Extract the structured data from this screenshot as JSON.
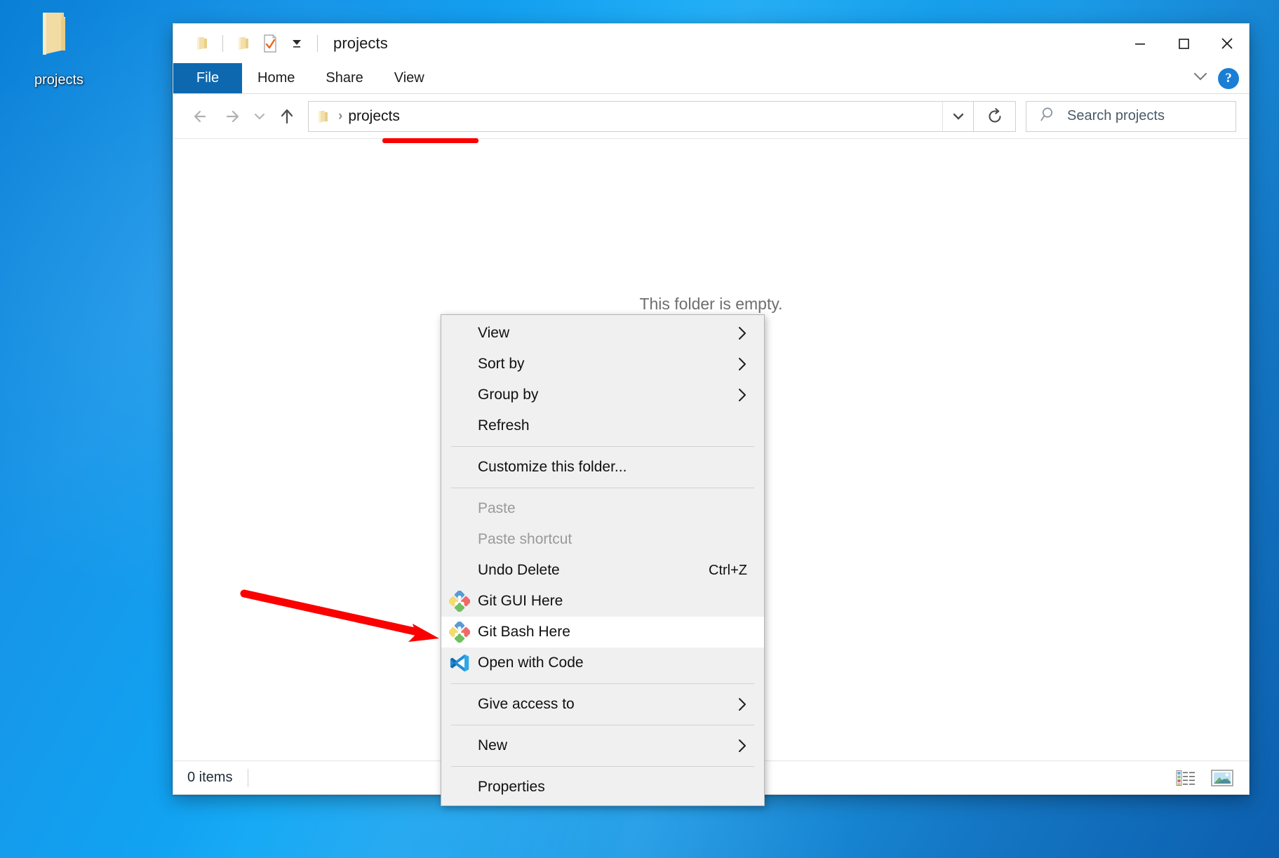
{
  "desktop": {
    "icon": {
      "name": "projects",
      "icon": "folder-icon"
    }
  },
  "window": {
    "title": "projects",
    "quick_access": [
      {
        "name": "folder-icon"
      },
      {
        "name": "folder-icon"
      },
      {
        "name": "properties-checkmark-icon"
      },
      {
        "name": "chevron-down-icon"
      }
    ],
    "controls": {
      "minimize": "minimize-icon",
      "maximize": "maximize-icon",
      "close": "close-icon"
    },
    "ribbon": {
      "tabs": [
        {
          "label": "File",
          "active": true
        },
        {
          "label": "Home",
          "active": false
        },
        {
          "label": "Share",
          "active": false
        },
        {
          "label": "View",
          "active": false
        }
      ],
      "expand_icon": "chevron-down-icon",
      "help_label": "?"
    },
    "address_bar": {
      "back_icon": "arrow-left-icon",
      "forward_icon": "arrow-right-icon",
      "recent_icon": "chevron-down-icon",
      "up_icon": "arrow-up-icon",
      "folder_icon": "folder-icon",
      "separator": "›",
      "path": "projects",
      "dropdown_icon": "chevron-down-icon",
      "refresh_icon": "refresh-icon"
    },
    "search": {
      "icon": "search-icon",
      "placeholder": "Search projects"
    },
    "content": {
      "empty_message": "This folder is empty."
    },
    "status_bar": {
      "items_count": "0 items",
      "view_buttons": [
        {
          "name": "details-view-icon"
        },
        {
          "name": "large-icons-view-icon"
        }
      ]
    }
  },
  "context_menu": {
    "items": [
      {
        "label": "View",
        "icon": null,
        "submenu": true,
        "disabled": false,
        "accel": null,
        "highlight": false
      },
      {
        "label": "Sort by",
        "icon": null,
        "submenu": true,
        "disabled": false,
        "accel": null,
        "highlight": false
      },
      {
        "label": "Group by",
        "icon": null,
        "submenu": true,
        "disabled": false,
        "accel": null,
        "highlight": false
      },
      {
        "label": "Refresh",
        "icon": null,
        "submenu": false,
        "disabled": false,
        "accel": null,
        "highlight": false
      },
      {
        "separator": true
      },
      {
        "label": "Customize this folder...",
        "icon": null,
        "submenu": false,
        "disabled": false,
        "accel": null,
        "highlight": false
      },
      {
        "separator": true
      },
      {
        "label": "Paste",
        "icon": null,
        "submenu": false,
        "disabled": true,
        "accel": null,
        "highlight": false
      },
      {
        "label": "Paste shortcut",
        "icon": null,
        "submenu": false,
        "disabled": true,
        "accel": null,
        "highlight": false
      },
      {
        "label": "Undo Delete",
        "icon": null,
        "submenu": false,
        "disabled": false,
        "accel": "Ctrl+Z",
        "highlight": false
      },
      {
        "label": "Git GUI Here",
        "icon": "git-icon",
        "submenu": false,
        "disabled": false,
        "accel": null,
        "highlight": false
      },
      {
        "label": "Git Bash Here",
        "icon": "git-icon",
        "submenu": false,
        "disabled": false,
        "accel": null,
        "highlight": true
      },
      {
        "label": "Open with Code",
        "icon": "vscode-icon",
        "submenu": false,
        "disabled": false,
        "accel": null,
        "highlight": false
      },
      {
        "separator": true
      },
      {
        "label": "Give access to",
        "icon": null,
        "submenu": true,
        "disabled": false,
        "accel": null,
        "highlight": false
      },
      {
        "separator": true
      },
      {
        "label": "New",
        "icon": null,
        "submenu": true,
        "disabled": false,
        "accel": null,
        "highlight": false
      },
      {
        "separator": true
      },
      {
        "label": "Properties",
        "icon": null,
        "submenu": false,
        "disabled": false,
        "accel": null,
        "highlight": false
      }
    ]
  },
  "annotations": {
    "color": "#fb0000",
    "arrow": {
      "name": "red-arrow-pointing-to-git-bash-here"
    },
    "underline": {
      "name": "red-underline-under-path"
    }
  },
  "colors": {
    "accent_blue": "#0d68b0",
    "desktop_blue": "#0fa7f5",
    "menu_bg": "#f0f0f0",
    "annotation_red": "#fb0000"
  }
}
